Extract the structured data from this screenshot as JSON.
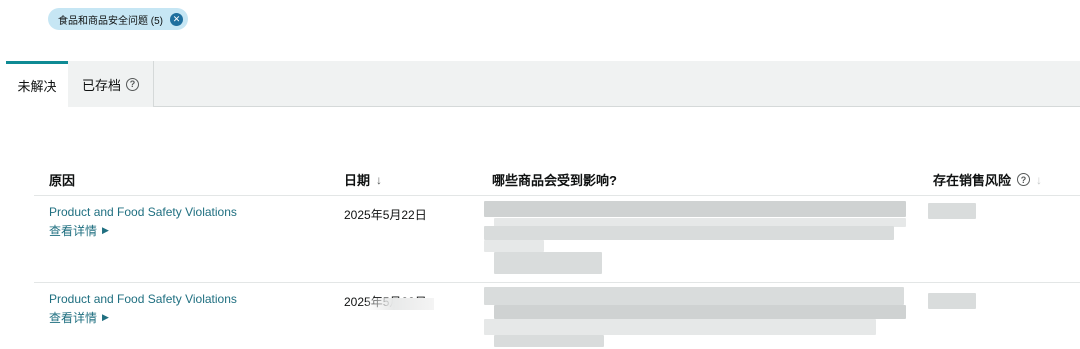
{
  "filter_chip": {
    "label": "食品和商品安全问题 (5)",
    "close_glyph": "✕"
  },
  "tabs": [
    {
      "label": "未解决",
      "active": true
    },
    {
      "label": "已存档",
      "active": false,
      "help_glyph": "?"
    }
  ],
  "table": {
    "headers": {
      "reason": "原因",
      "date": "日期",
      "date_sort_glyph": "↓",
      "affected": "哪些商品会受到影响?",
      "risk": "存在销售风险",
      "risk_help_glyph": "?",
      "risk_sort_glyph": "↓"
    },
    "rows": [
      {
        "reason": "Product and Food Safety Violations",
        "details_label": "查看详情",
        "details_glyph": "▶",
        "date": "2025年5月22日"
      },
      {
        "reason": "Product and Food Safety Violations",
        "details_label": "查看详情",
        "details_glyph": "▶",
        "date": "2025年5月22日"
      }
    ]
  },
  "colors": {
    "accent": "#0e8a94",
    "link": "#1f6f80",
    "chip_bg": "#c6e6f4",
    "tabbar_bg": "#f0f2f2"
  }
}
